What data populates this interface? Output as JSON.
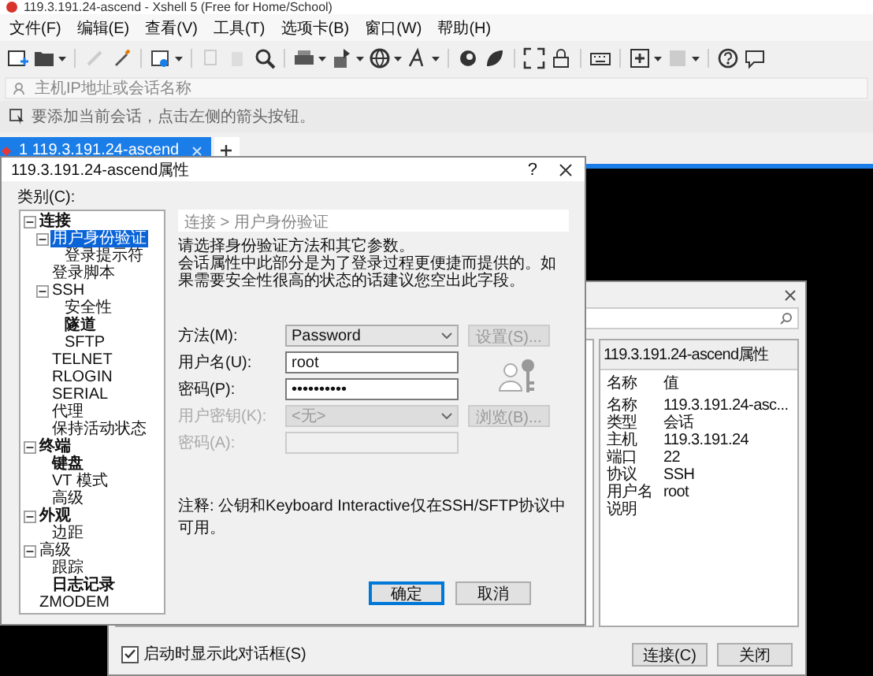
{
  "main_window": {
    "title": "119.3.191.24-ascend - Xshell 5 (Free for Home/School)",
    "menu": [
      "文件(F)",
      "编辑(E)",
      "查看(V)",
      "工具(T)",
      "选项卡(B)",
      "窗口(W)",
      "帮助(H)"
    ],
    "address": {
      "placeholder": "主机IP地址或会话名称"
    },
    "hint": "要添加当前会话，点击左侧的箭头按钮。",
    "tabs": [
      {
        "number": "1",
        "label": "119.3.191.24-ascend",
        "selected": true
      }
    ]
  },
  "session_dialog": {
    "properties_title": "119.3.191.24-ascend属性",
    "columns": [
      "名称",
      "值"
    ],
    "rows": [
      {
        "name": "名称",
        "value": "119.3.191.24-asc..."
      },
      {
        "name": "类型",
        "value": "会话"
      },
      {
        "name": "主机",
        "value": "119.3.191.24"
      },
      {
        "name": "端口",
        "value": "22"
      },
      {
        "name": "协议",
        "value": "SSH"
      },
      {
        "name": "用户名",
        "value": "root"
      },
      {
        "name": "说明"
      }
    ],
    "startup_checkbox": {
      "label": "启动时显示此对话框(S)",
      "checked": true
    },
    "buttons": [
      "连接(C)",
      "关闭"
    ]
  },
  "properties_dialog": {
    "title": "119.3.191.24-ascend属性",
    "help": "?",
    "category_label": "类别(C):",
    "tree": [
      {
        "label": "连接",
        "bold": true,
        "selected": false,
        "expanded": true,
        "children": [
          {
            "label": "用户身份验证",
            "bold": false,
            "selected": true,
            "expanded": true,
            "children": [
              {
                "label": "登录提示符",
                "bold": false,
                "selected": false
              }
            ]
          },
          {
            "label": "登录脚本",
            "bold": false,
            "selected": false
          },
          {
            "label": "SSH",
            "bold": false,
            "selected": false,
            "expanded": true,
            "children": [
              {
                "label": "安全性",
                "bold": false,
                "selected": false
              },
              {
                "label": "隧道",
                "bold": true,
                "selected": false
              },
              {
                "label": "SFTP",
                "bold": false,
                "selected": false
              }
            ]
          },
          {
            "label": "TELNET",
            "bold": false,
            "selected": false
          },
          {
            "label": "RLOGIN",
            "bold": false,
            "selected": false
          },
          {
            "label": "SERIAL",
            "bold": false,
            "selected": false
          },
          {
            "label": "代理",
            "bold": false,
            "selected": false
          },
          {
            "label": "保持活动状态",
            "bold": false,
            "selected": false
          }
        ]
      },
      {
        "label": "终端",
        "bold": true,
        "selected": false,
        "expanded": true,
        "children": [
          {
            "label": "键盘",
            "bold": true,
            "selected": false
          },
          {
            "label": "VT 模式",
            "bold": false,
            "selected": false
          },
          {
            "label": "高级",
            "bold": false,
            "selected": false
          }
        ]
      },
      {
        "label": "外观",
        "bold": true,
        "selected": false,
        "expanded": true,
        "children": [
          {
            "label": "边距",
            "bold": false,
            "selected": false
          }
        ]
      },
      {
        "label": "高级",
        "bold": false,
        "selected": false,
        "expanded": true,
        "children": [
          {
            "label": "跟踪",
            "bold": false,
            "selected": false
          },
          {
            "label": "日志记录",
            "bold": true,
            "selected": false
          }
        ]
      },
      {
        "label": "ZMODEM",
        "bold": false,
        "selected": false
      }
    ],
    "breadcrumb": "连接 > 用户身份验证",
    "description": [
      "请选择身份验证方法和其它参数。",
      "会话属性中此部分是为了登录过程更便捷而提供的。如果需要安全性很高的状态的话建议您空出此字段。"
    ],
    "fields": [
      {
        "kind": "select",
        "label": "方法(M):",
        "value": "Password",
        "disabled": false
      },
      {
        "kind": "text",
        "label": "用户名(U):",
        "value": "root",
        "disabled": false
      },
      {
        "kind": "text",
        "label": "密码(P):",
        "value": "••••••••••",
        "disabled": false
      },
      {
        "kind": "select",
        "label": "用户密钥(K):",
        "value": "<无>",
        "disabled": true
      },
      {
        "kind": "text",
        "label": "密码(A):",
        "disabled": true
      }
    ],
    "side_buttons": [
      {
        "label": "设置(S)...",
        "disabled": true
      },
      {
        "label": "浏览(B)...",
        "disabled": true
      }
    ],
    "note": "注释: 公钥和Keyboard Interactive仅在SSH/SFTP协议中可用。",
    "buttons": [
      {
        "label": "确定",
        "default": true
      },
      {
        "label": "取消",
        "default": false
      }
    ]
  }
}
